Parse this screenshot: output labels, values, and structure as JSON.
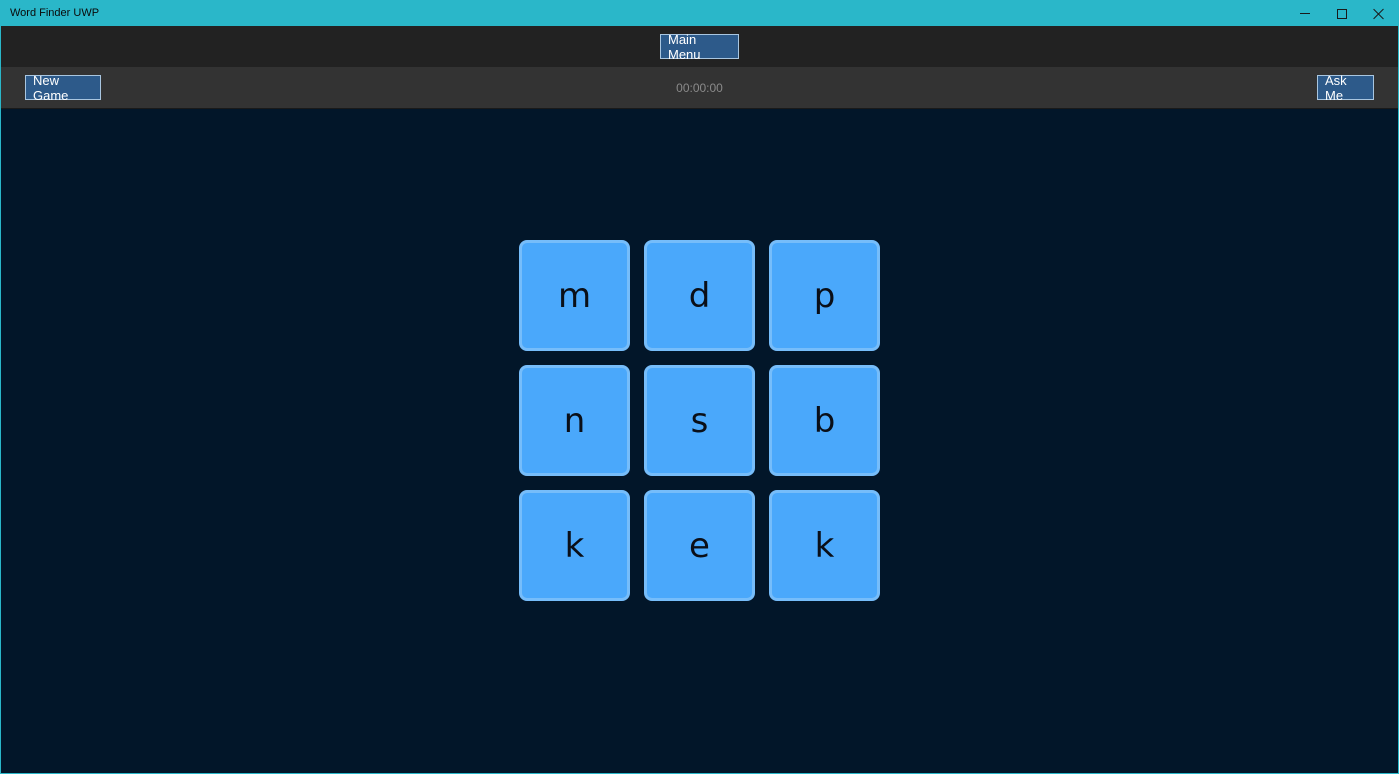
{
  "window": {
    "title": "Word Finder UWP"
  },
  "topbar": {
    "main_menu_label": "Main Menu"
  },
  "toolbar": {
    "new_game_label": "New Game",
    "timer": "00:00:00",
    "ask_me_label": "Ask Me"
  },
  "board": {
    "tiles": [
      "m",
      "d",
      "p",
      "n",
      "s",
      "b",
      "k",
      "e",
      "k"
    ]
  },
  "colors": {
    "accent": "#2ab7c9",
    "background": "#021629",
    "tile": "#4aa8fb",
    "button": "#2d5a8a"
  }
}
